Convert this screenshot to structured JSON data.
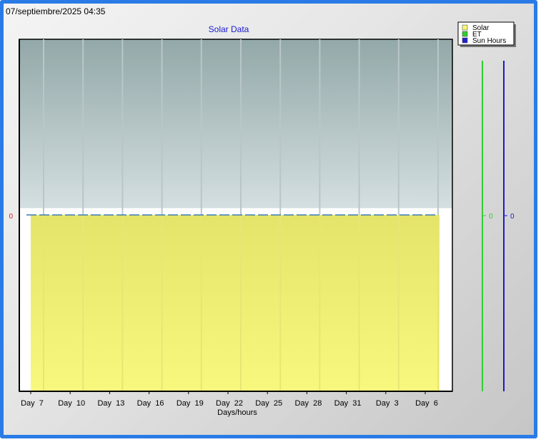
{
  "header": {
    "timestamp": "07/septiembre/2025 04:35"
  },
  "chart_data": {
    "type": "area",
    "title": "Solar Data",
    "xlabel": "Days/hours",
    "x_ticks": [
      "Day  7",
      "Day  10",
      "Day  13",
      "Day  16",
      "Day  19",
      "Day  22",
      "Day  25",
      "Day  28",
      "Day  31",
      "Day  3",
      "Day  6"
    ],
    "series": [
      {
        "name": "Solar",
        "color": "#f6f67a",
        "values": [
          0,
          0,
          0,
          0,
          0,
          0,
          0,
          0,
          0,
          0,
          0,
          0,
          0,
          0,
          0,
          0,
          0,
          0,
          0,
          0,
          0,
          0,
          0,
          0,
          0,
          0,
          0,
          0,
          0,
          0,
          0,
          0
        ]
      },
      {
        "name": "ET",
        "color": "#33cc33",
        "values": [
          0,
          0,
          0,
          0,
          0,
          0,
          0,
          0,
          0,
          0,
          0,
          0,
          0,
          0,
          0,
          0,
          0,
          0,
          0,
          0,
          0,
          0,
          0,
          0,
          0,
          0,
          0,
          0,
          0,
          0,
          0,
          0
        ]
      },
      {
        "name": "Sun Hours",
        "color": "#2222cc",
        "values": [
          0,
          0,
          0,
          0,
          0,
          0,
          0,
          0,
          0,
          0,
          0,
          0,
          0,
          0,
          0,
          0,
          0,
          0,
          0,
          0,
          0,
          0,
          0,
          0,
          0,
          0,
          0,
          0,
          0,
          0,
          0,
          0
        ]
      }
    ],
    "axes": {
      "solar_tick": "0",
      "et_tick": "0",
      "sun_hours_tick": "0",
      "solar_tick_color": "#dd2222",
      "et_color": "#33cc33",
      "sun_hours_color": "#1a1acc"
    },
    "legend": {
      "placement": "top-right",
      "entries": [
        "Solar",
        "ET",
        "Sun Hours"
      ]
    },
    "grid": true
  }
}
